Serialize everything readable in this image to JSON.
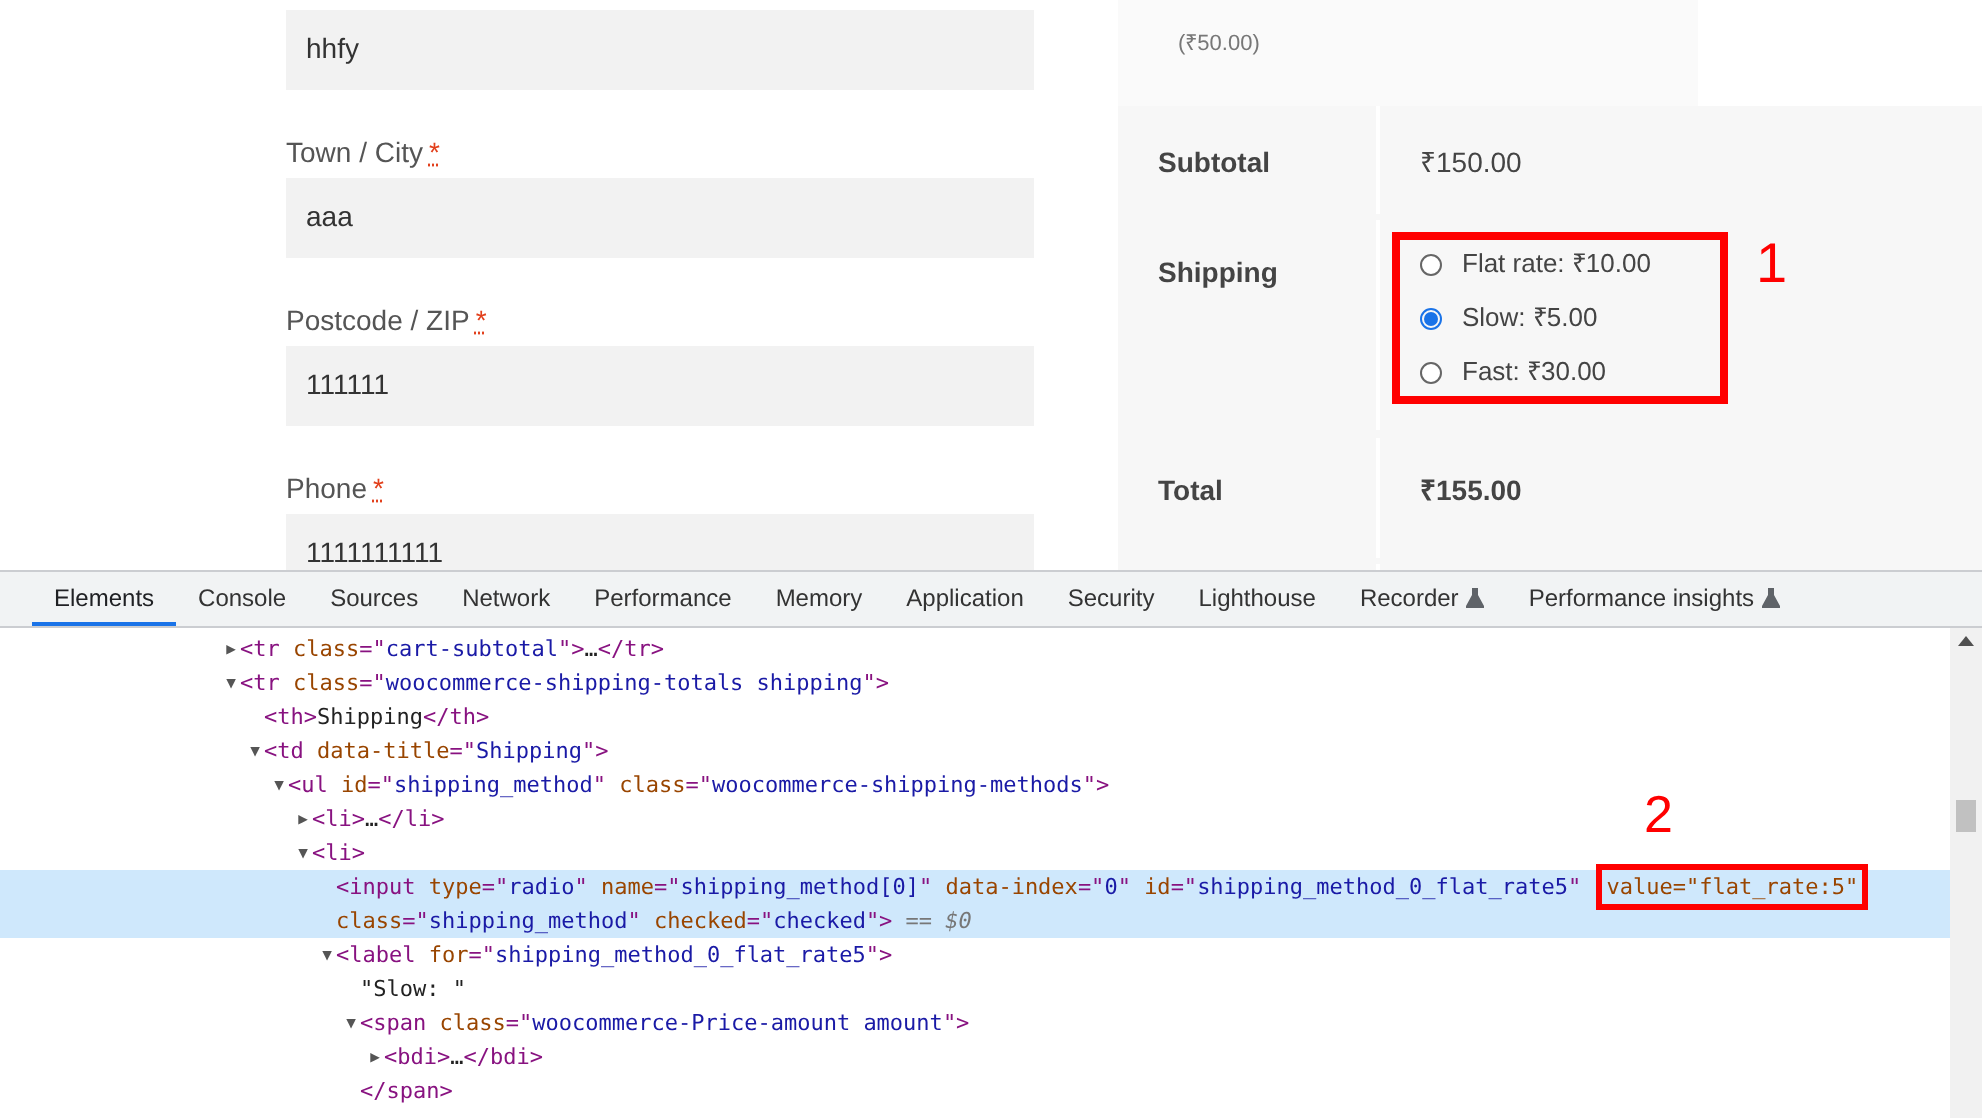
{
  "form": {
    "fields": [
      {
        "value": "hhfy"
      },
      {
        "label": "Town / City",
        "required": "*",
        "value": "aaa"
      },
      {
        "label": "Postcode / ZIP",
        "required": "*",
        "value": "111111"
      },
      {
        "label": "Phone",
        "required": "*",
        "value": "1111111111"
      }
    ]
  },
  "order_summary": {
    "item_price": "(₹50.00)",
    "subtotal": {
      "label": "Subtotal",
      "value": "₹150.00"
    },
    "shipping": {
      "label": "Shipping",
      "annotation": "1",
      "options": [
        {
          "label": "Flat rate: ₹10.00",
          "selected": false
        },
        {
          "label": "Slow: ₹5.00",
          "selected": true
        },
        {
          "label": "Fast: ₹30.00",
          "selected": false
        }
      ]
    },
    "total": {
      "label": "Total",
      "value": "₹155.00"
    }
  },
  "devtools": {
    "tabs": [
      {
        "label": "Elements",
        "selected": true,
        "experimental": false
      },
      {
        "label": "Console",
        "selected": false,
        "experimental": false
      },
      {
        "label": "Sources",
        "selected": false,
        "experimental": false
      },
      {
        "label": "Network",
        "selected": false,
        "experimental": false
      },
      {
        "label": "Performance",
        "selected": false,
        "experimental": false
      },
      {
        "label": "Memory",
        "selected": false,
        "experimental": false
      },
      {
        "label": "Application",
        "selected": false,
        "experimental": false
      },
      {
        "label": "Security",
        "selected": false,
        "experimental": false
      },
      {
        "label": "Lighthouse",
        "selected": false,
        "experimental": false
      },
      {
        "label": "Recorder",
        "selected": false,
        "experimental": true
      },
      {
        "label": "Performance insights",
        "selected": false,
        "experimental": true
      }
    ],
    "annotation": "2",
    "tree": [
      {
        "arrow": "▶",
        "selected": false,
        "tokens": [
          {
            "kind": "tag",
            "text": "<tr "
          },
          {
            "kind": "attr",
            "text": "class"
          },
          {
            "kind": "tag",
            "text": "=\""
          },
          {
            "kind": "val",
            "text": "cart-subtotal"
          },
          {
            "kind": "tag",
            "text": "\">"
          },
          {
            "kind": "text",
            "text": "…"
          },
          {
            "kind": "tag",
            "text": "</tr>"
          }
        ]
      },
      {
        "arrow": "▼",
        "selected": false,
        "tokens": [
          {
            "kind": "tag",
            "text": "<tr "
          },
          {
            "kind": "attr",
            "text": "class"
          },
          {
            "kind": "tag",
            "text": "=\""
          },
          {
            "kind": "val",
            "text": "woocommerce-shipping-totals shipping"
          },
          {
            "kind": "tag",
            "text": "\">"
          }
        ],
        "children": [
          {
            "selected": false,
            "tokens": [
              {
                "kind": "tag",
                "text": "<th>"
              },
              {
                "kind": "text",
                "text": "Shipping"
              },
              {
                "kind": "tag",
                "text": "</th>"
              }
            ]
          },
          {
            "arrow": "▼",
            "selected": false,
            "tokens": [
              {
                "kind": "tag",
                "text": "<td "
              },
              {
                "kind": "attr",
                "text": "data-title"
              },
              {
                "kind": "tag",
                "text": "=\""
              },
              {
                "kind": "val",
                "text": "Shipping"
              },
              {
                "kind": "tag",
                "text": "\">"
              }
            ],
            "children": [
              {
                "arrow": "▼",
                "selected": false,
                "tokens": [
                  {
                    "kind": "tag",
                    "text": "<ul "
                  },
                  {
                    "kind": "attr",
                    "text": "id"
                  },
                  {
                    "kind": "tag",
                    "text": "=\""
                  },
                  {
                    "kind": "val",
                    "text": "shipping_method"
                  },
                  {
                    "kind": "tag",
                    "text": "\" "
                  },
                  {
                    "kind": "attr",
                    "text": "class"
                  },
                  {
                    "kind": "tag",
                    "text": "=\""
                  },
                  {
                    "kind": "val",
                    "text": "woocommerce-shipping-methods"
                  },
                  {
                    "kind": "tag",
                    "text": "\">"
                  }
                ],
                "children": [
                  {
                    "arrow": "▶",
                    "selected": false,
                    "tokens": [
                      {
                        "kind": "tag",
                        "text": "<li>"
                      },
                      {
                        "kind": "text",
                        "text": "…"
                      },
                      {
                        "kind": "tag",
                        "text": "</li>"
                      }
                    ]
                  },
                  {
                    "arrow": "▼",
                    "selected": false,
                    "tokens": [
                      {
                        "kind": "tag",
                        "text": "<li>"
                      }
                    ],
                    "children": [
                      {
                        "selected": true,
                        "tokens": [
                          {
                            "kind": "tag",
                            "text": "<input "
                          },
                          {
                            "kind": "attr",
                            "text": "type"
                          },
                          {
                            "kind": "tag",
                            "text": "=\""
                          },
                          {
                            "kind": "val",
                            "text": "radio"
                          },
                          {
                            "kind": "tag",
                            "text": "\" "
                          },
                          {
                            "kind": "attr",
                            "text": "name"
                          },
                          {
                            "kind": "tag",
                            "text": "=\""
                          },
                          {
                            "kind": "val",
                            "text": "shipping_method[0]"
                          },
                          {
                            "kind": "tag",
                            "text": "\" "
                          },
                          {
                            "kind": "attr",
                            "text": "data-index"
                          },
                          {
                            "kind": "tag",
                            "text": "=\""
                          },
                          {
                            "kind": "val",
                            "text": "0"
                          },
                          {
                            "kind": "tag",
                            "text": "\" "
                          },
                          {
                            "kind": "attr",
                            "text": "id"
                          },
                          {
                            "kind": "tag",
                            "text": "=\""
                          },
                          {
                            "kind": "val",
                            "text": "shipping_method_0_flat_rate5"
                          },
                          {
                            "kind": "tag",
                            "text": "\" "
                          },
                          {
                            "kind": "boxed",
                            "text": "value=\"flat_rate:5\""
                          },
                          {
                            "kind": "break"
                          },
                          {
                            "kind": "attr",
                            "text": "class"
                          },
                          {
                            "kind": "tag",
                            "text": "=\""
                          },
                          {
                            "kind": "val",
                            "text": "shipping_method"
                          },
                          {
                            "kind": "tag",
                            "text": "\" "
                          },
                          {
                            "kind": "attr",
                            "text": "checked"
                          },
                          {
                            "kind": "tag",
                            "text": "=\""
                          },
                          {
                            "kind": "val",
                            "text": "checked"
                          },
                          {
                            "kind": "tag",
                            "text": "\">"
                          },
                          {
                            "kind": "dim",
                            "text": " == $0"
                          }
                        ]
                      },
                      {
                        "arrow": "▼",
                        "selected": false,
                        "tokens": [
                          {
                            "kind": "tag",
                            "text": "<label "
                          },
                          {
                            "kind": "attr",
                            "text": "for"
                          },
                          {
                            "kind": "tag",
                            "text": "=\""
                          },
                          {
                            "kind": "val",
                            "text": "shipping_method_0_flat_rate5"
                          },
                          {
                            "kind": "tag",
                            "text": "\">"
                          }
                        ],
                        "children": [
                          {
                            "selected": false,
                            "tokens": [
                              {
                                "kind": "text",
                                "text": "\"Slow: \""
                              }
                            ]
                          },
                          {
                            "arrow": "▼",
                            "selected": false,
                            "tokens": [
                              {
                                "kind": "tag",
                                "text": "<span "
                              },
                              {
                                "kind": "attr",
                                "text": "class"
                              },
                              {
                                "kind": "tag",
                                "text": "=\""
                              },
                              {
                                "kind": "val",
                                "text": "woocommerce-Price-amount amount"
                              },
                              {
                                "kind": "tag",
                                "text": "\">"
                              }
                            ],
                            "closing": "</span>",
                            "children": [
                              {
                                "arrow": "▶",
                                "selected": false,
                                "tokens": [
                                  {
                                    "kind": "tag",
                                    "text": "<bdi>"
                                  },
                                  {
                                    "kind": "text",
                                    "text": "…"
                                  },
                                  {
                                    "kind": "tag",
                                    "text": "</bdi>"
                                  }
                                ]
                              }
                            ]
                          }
                        ]
                      }
                    ]
                  }
                ]
              }
            ]
          }
        ]
      }
    ]
  }
}
